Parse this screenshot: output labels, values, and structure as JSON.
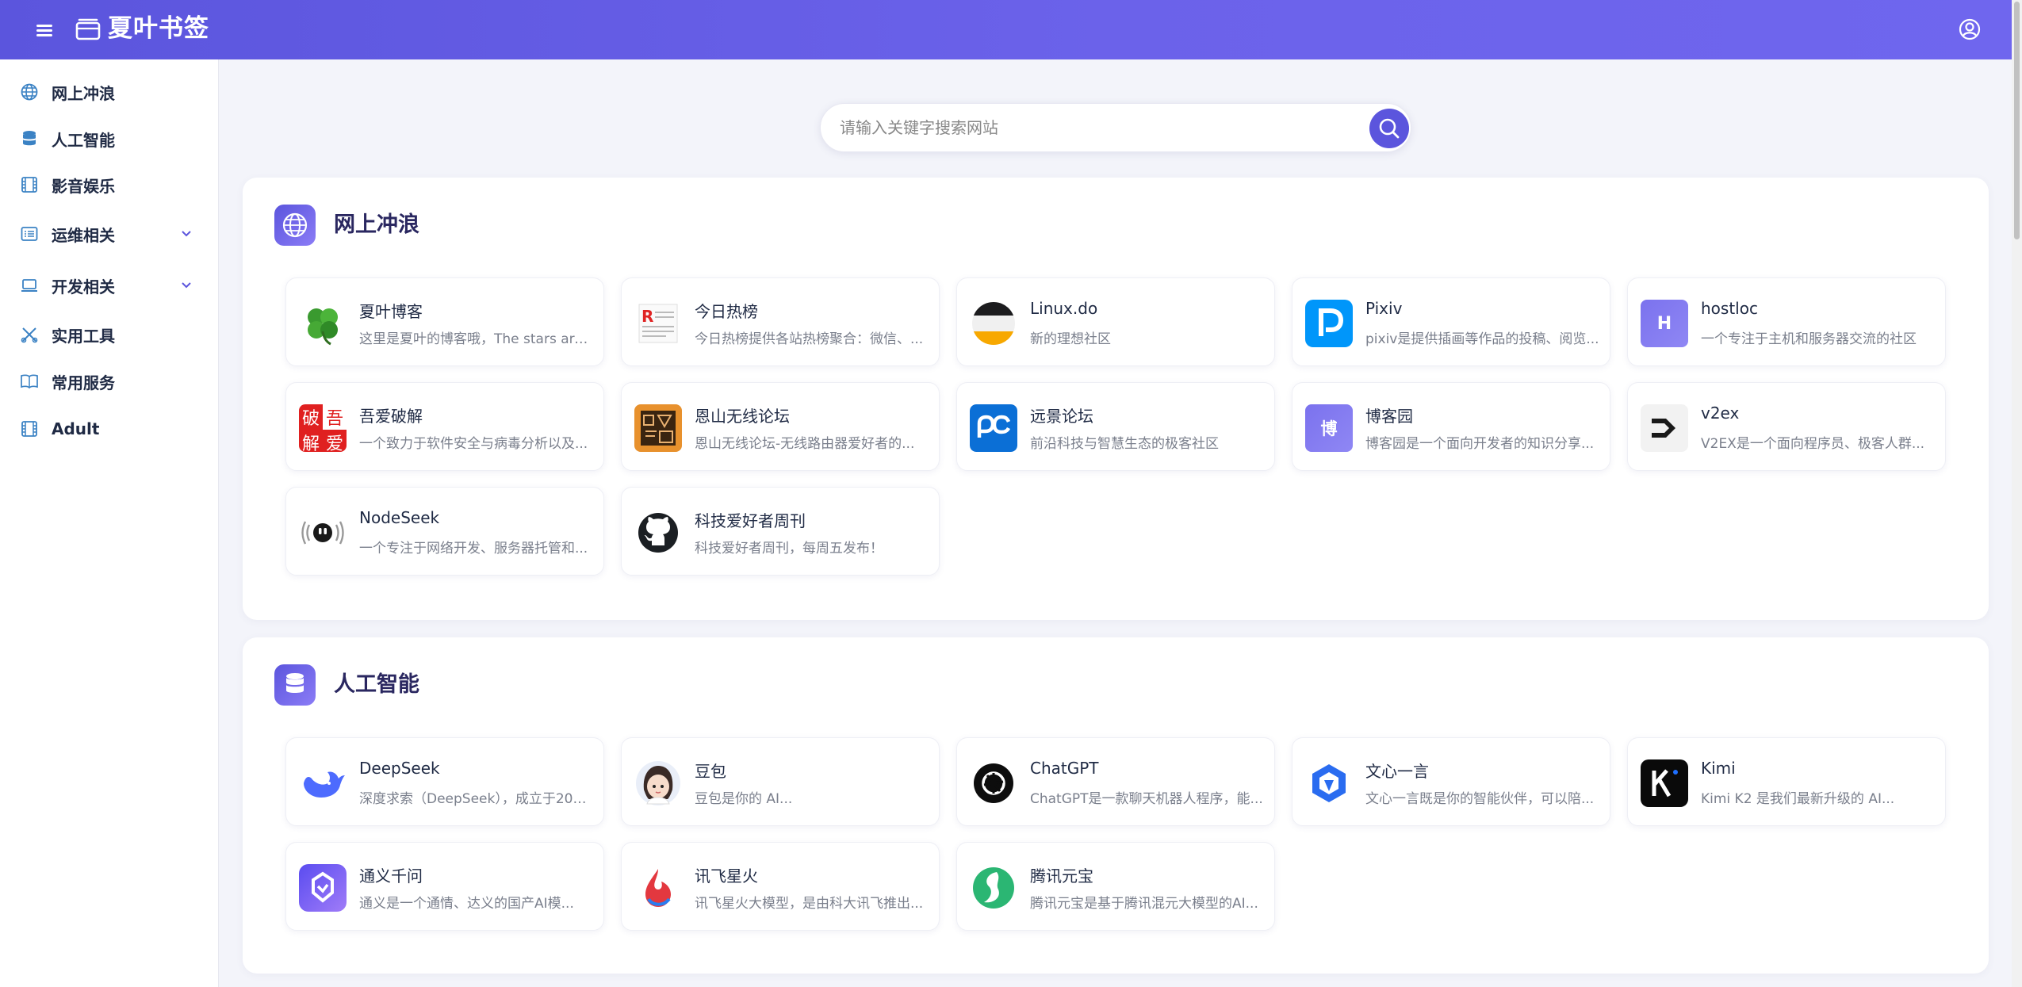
{
  "app": {
    "title": "夏叶书签"
  },
  "search": {
    "placeholder": "请输入关键字搜索网站"
  },
  "sidebar": {
    "items": [
      {
        "label": "网上冲浪",
        "icon": "globe-icon"
      },
      {
        "label": "人工智能",
        "icon": "database-icon"
      },
      {
        "label": "影音娱乐",
        "icon": "film-icon"
      },
      {
        "label": "运维相关",
        "icon": "list-icon",
        "expandable": true
      },
      {
        "label": "开发相关",
        "icon": "laptop-icon",
        "expandable": true
      },
      {
        "label": "实用工具",
        "icon": "tools-icon"
      },
      {
        "label": "常用服务",
        "icon": "book-icon"
      },
      {
        "label": "Adult",
        "icon": "film-icon"
      }
    ]
  },
  "sections": [
    {
      "title": "网上冲浪",
      "icon": "globe-icon",
      "cards": [
        {
          "name": "夏叶博客",
          "desc": "这里是夏叶的博客哦，The stars are...",
          "logo": "clover-logo"
        },
        {
          "name": "今日热榜",
          "desc": "今日热榜提供各站热榜聚合：微信、...",
          "logo": "rebang-logo"
        },
        {
          "name": "Linux.do",
          "desc": "新的理想社区",
          "logo": "linuxdo-logo"
        },
        {
          "name": "Pixiv",
          "desc": "pixiv是提供插画等作品的投稿、阅览...",
          "logo": "pixiv-logo"
        },
        {
          "name": "hostloc",
          "desc": "一个专注于主机和服务器交流的社区",
          "logo": "hostloc-logo",
          "logo_text": "H"
        },
        {
          "name": "吾爱破解",
          "desc": "一个致力于软件安全与病毒分析以及...",
          "logo": "52pojie-logo",
          "logo_chars": [
            "破",
            "吾",
            "解",
            "爱"
          ]
        },
        {
          "name": "恩山无线论坛",
          "desc": "恩山无线论坛-无线路由器爱好者的...",
          "logo": "right-logo"
        },
        {
          "name": "远景论坛",
          "desc": "前沿科技与智慧生态的极客社区",
          "logo": "pcbeta-logo"
        },
        {
          "name": "博客园",
          "desc": "博客园是一个面向开发者的知识分享...",
          "logo": "cnblogs-logo",
          "logo_text": "博"
        },
        {
          "name": "v2ex",
          "desc": "V2EX是一个面向程序员、极客人群...",
          "logo": "v2ex-logo"
        },
        {
          "name": "NodeSeek",
          "desc": "一个专注于网络开发、服务器托管和...",
          "logo": "nodeseek-logo"
        },
        {
          "name": "科技爱好者周刊",
          "desc": "科技爱好者周刊，每周五发布！",
          "logo": "github-logo"
        }
      ]
    },
    {
      "title": "人工智能",
      "icon": "database-icon",
      "cards": [
        {
          "name": "DeepSeek",
          "desc": "深度求索（DeepSeek），成立于202...",
          "logo": "deepseek-logo"
        },
        {
          "name": "豆包",
          "desc": "豆包是你的 AI...",
          "logo": "doubao-logo"
        },
        {
          "name": "ChatGPT",
          "desc": "ChatGPT是一款聊天机器人程序，能...",
          "logo": "chatgpt-logo"
        },
        {
          "name": "文心一言",
          "desc": "文心一言既是你的智能伙伴，可以陪...",
          "logo": "wenxin-logo"
        },
        {
          "name": "Kimi",
          "desc": "Kimi K2 是我们最新升级的 AI...",
          "logo": "kimi-logo"
        },
        {
          "name": "通义千问",
          "desc": "通义是一个通情、达义的国产AI模...",
          "logo": "tongyi-logo"
        },
        {
          "name": "讯飞星火",
          "desc": "讯飞星火大模型，是由科大讯飞推出...",
          "logo": "xinghuo-logo"
        },
        {
          "name": "腾讯元宝",
          "desc": "腾讯元宝是基于腾讯混元大模型的AI...",
          "logo": "yuanbao-logo"
        }
      ]
    }
  ],
  "colors": {
    "accent": "#5b55dd",
    "header_end": "#6f66ee",
    "background": "#f3f4fa"
  }
}
